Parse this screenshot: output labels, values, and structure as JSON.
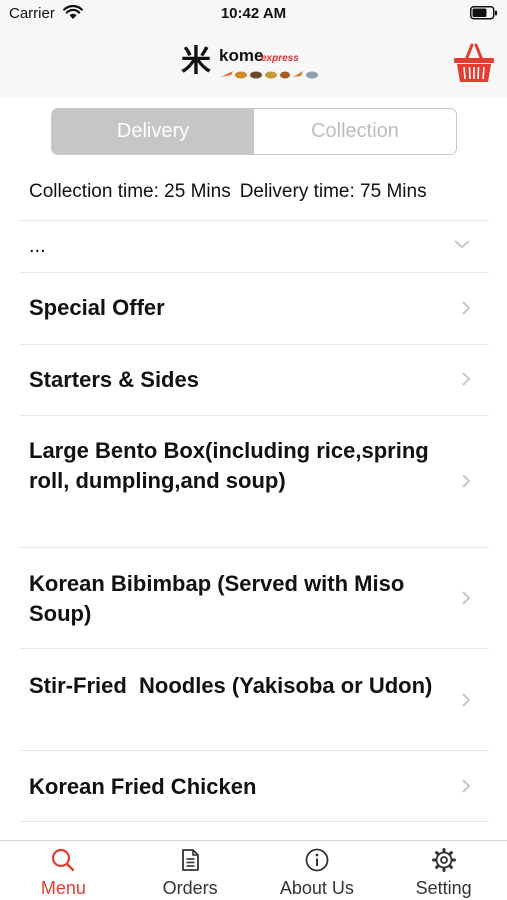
{
  "status": {
    "carrier": "Carrier",
    "time": "10:42 AM"
  },
  "header": {
    "logo_mark": "米",
    "logo_name": "kome",
    "logo_sub": "express",
    "accent": "#e43d30",
    "icons": [
      "cart-icon"
    ]
  },
  "order_type": {
    "selected": "Delivery",
    "options": [
      "Delivery",
      "Collection"
    ]
  },
  "times": {
    "collection": "Collection time: 25 Mins",
    "delivery": "Delivery time: 75 Mins"
  },
  "menu": {
    "dropdown_label": "...",
    "categories": [
      "Special Offer",
      "Starters & Sides",
      "Large Bento Box(including rice,spring roll, dumpling,and soup)",
      "Korean Bibimbap (Served with Miso Soup)",
      "Stir-Fried  Noodles (Yakisoba or Udon)",
      "Korean Fried Chicken"
    ]
  },
  "tabs": [
    {
      "label": "Menu",
      "icon": "search-icon",
      "active": true
    },
    {
      "label": "Orders",
      "icon": "document-icon",
      "active": false
    },
    {
      "label": "About Us",
      "icon": "info-icon",
      "active": false
    },
    {
      "label": "Setting",
      "icon": "gear-icon",
      "active": false
    }
  ]
}
